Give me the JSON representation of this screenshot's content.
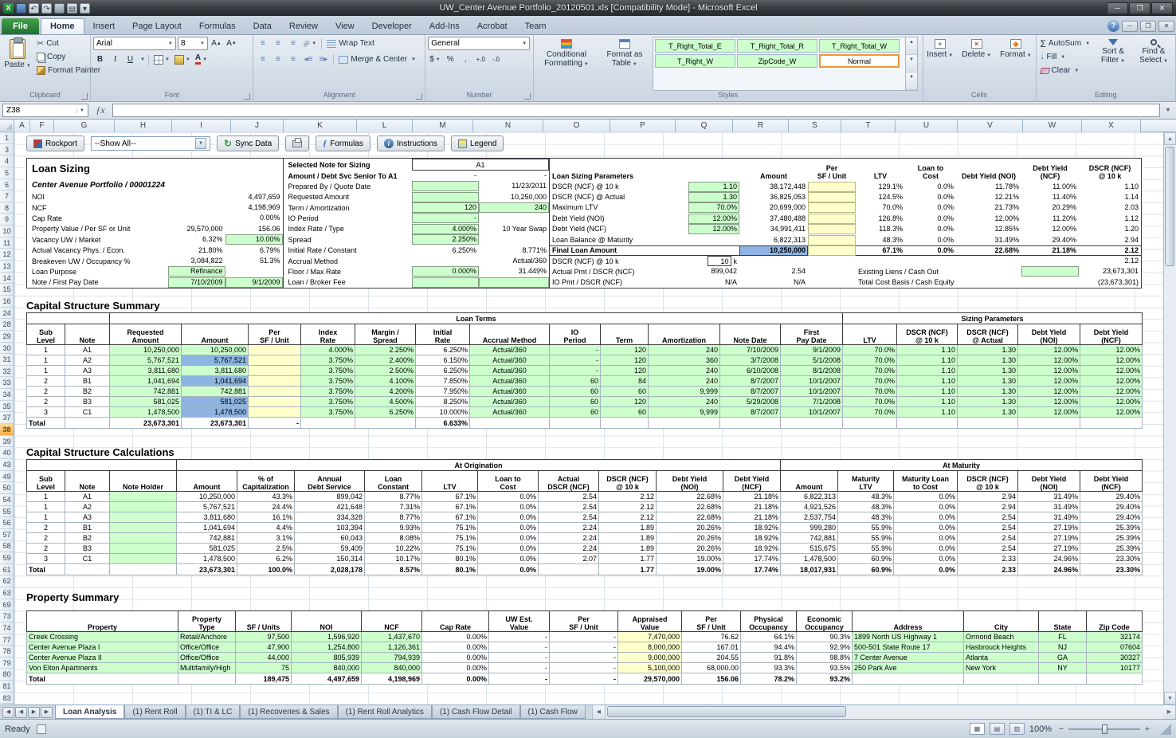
{
  "colors": {
    "input_green": "#ccffcc",
    "highlight_blue": "#8db4e2",
    "pale_yellow": "#ffffcc",
    "accent_orange": "#f29536"
  },
  "window": {
    "title": "UW_Center Avenue Portfolio_20120501.xls  [Compatibility Mode] -  Microsoft Excel"
  },
  "ribbon": {
    "tabs": [
      "File",
      "Home",
      "Insert",
      "Page Layout",
      "Formulas",
      "Data",
      "Review",
      "View",
      "Developer",
      "Add-Ins",
      "Acrobat",
      "Team"
    ],
    "active_tab": "Home",
    "groups": {
      "clipboard": {
        "label": "Clipboard",
        "paste": "Paste",
        "cut": "Cut",
        "copy": "Copy",
        "format_painter": "Format Painter"
      },
      "font": {
        "label": "Font",
        "family": "Arial",
        "size": "8"
      },
      "alignment": {
        "label": "Alignment",
        "wrap_text": "Wrap Text",
        "merge_center": "Merge & Center"
      },
      "number": {
        "label": "Number",
        "format": "General"
      },
      "styles": {
        "label": "Styles",
        "conditional_formatting": "Conditional Formatting",
        "format_as_table": "Format as Table",
        "cell_styles": [
          "T_Right_Total_E",
          "T_Right_Total_R",
          "T_Right_Total_W",
          "T_Right_W",
          "ZipCode_W",
          "Normal"
        ],
        "selected_style": "Normal"
      },
      "cells": {
        "label": "Cells",
        "insert": "Insert",
        "delete": "Delete",
        "format": "Format"
      },
      "editing": {
        "label": "Editing",
        "autosum": "AutoSum",
        "fill": "Fill",
        "clear": "Clear",
        "sort_filter": "Sort & Filter",
        "find_select": "Find & Select"
      }
    }
  },
  "formula_bar": {
    "name_box": "Z38",
    "formula": ""
  },
  "grid": {
    "columns": [
      "A",
      "F",
      "G",
      "H",
      "I",
      "J",
      "K",
      "L",
      "M",
      "N",
      "O",
      "P",
      "Q",
      "R",
      "S",
      "T",
      "U",
      "V",
      "W",
      "X"
    ],
    "rows": [
      "1",
      "3",
      "4",
      "5",
      "6",
      "7",
      "8",
      "9",
      "10",
      "11",
      "12",
      "13",
      "14",
      "15",
      "16",
      "24",
      "28",
      "29",
      "30",
      "31",
      "32",
      "33",
      "34",
      "35",
      "37",
      "38",
      "39",
      "40",
      "43",
      "49",
      "50",
      "54",
      "55",
      "56",
      "57",
      "58",
      "59",
      "61",
      "62",
      "63",
      "69",
      "73",
      "74",
      "77",
      "78",
      "79",
      "80",
      "81",
      "83"
    ],
    "selected_row": "38"
  },
  "sheet_toolbar": {
    "rockport": "Rockport",
    "show_all": "--Show All--",
    "sync_data": "Sync Data",
    "formulas": "Formulas",
    "instructions": "Instructions",
    "legend": "Legend"
  },
  "loan_sizing": {
    "title": "Loan Sizing",
    "subtitle": "Center Avenue Portfolio / 00001224",
    "left_rows": [
      [
        "NOI",
        "",
        "4,497,659",
        "--"
      ],
      [
        "NCF",
        "",
        "4,198,969",
        "--"
      ],
      [
        "Cap Rate",
        "",
        "0.00%",
        "--"
      ],
      [
        "Property Value / Per SF or Unit",
        "29,570,000",
        "156.06",
        "--"
      ],
      [
        "Vacancy UW / Market",
        "6.32%",
        "10.00%",
        "-g"
      ],
      [
        "Actual Vacancy Phys. / Econ.",
        "21.80%",
        "6.79%",
        "--"
      ],
      [
        "Breakeven UW / Occupancy %",
        "3,084,822",
        "51.3%",
        "--"
      ],
      [
        "Loan Purpose",
        "Refinance",
        "",
        "g-"
      ],
      [
        "Note / First Pay Date",
        "7/10/2009",
        "9/1/2009",
        "gg"
      ]
    ],
    "middle": {
      "selected_note_label": "Selected Note for Sizing",
      "selected_note": "A1",
      "senior_label": "Amount / Debt Svc Senior To A1",
      "senior_v1": "-",
      "senior_v2": "-",
      "rows": [
        [
          "Prepared By / Quote Date",
          "",
          "11/23/2011",
          "g-"
        ],
        [
          "Requested Amount",
          "",
          "10,250,000",
          "g-"
        ],
        [
          "Term / Amortization",
          "120",
          "240",
          "gg"
        ],
        [
          "IO Period",
          "-",
          "",
          "g-"
        ],
        [
          "Index Rate / Type",
          "4.000%",
          "10 Year Swap",
          "g-"
        ],
        [
          "Spread",
          "2.250%",
          "",
          "g-"
        ],
        [
          "Initial Rate / Constant",
          "6.250%",
          "8.771%",
          "--"
        ],
        [
          "Accrual Method",
          "",
          "Actual/360",
          "--"
        ],
        [
          "Floor / Max Rate",
          "0.000%",
          "31.449%",
          "g-"
        ],
        [
          "Loan / Broker Fee",
          "",
          "",
          "gg"
        ]
      ]
    },
    "params": {
      "header": [
        "Loan Sizing Parameters",
        "Amount",
        "Per\nSF / Unit",
        "LTV",
        "Loan to\nCost",
        "Debt Yield (NOI)",
        "Debt Yield\n(NCF)",
        "DSCR (NCF)\n@ 10 k"
      ],
      "rows": [
        [
          "DSCR (NCF) @ 10 k",
          "1.10",
          "38,172,448",
          "129.1%",
          "0.0%",
          "11.78%",
          "11.00%",
          "1.10",
          "g"
        ],
        [
          "DSCR (NCF) @ Actual",
          "1.30",
          "36,825,053",
          "124.5%",
          "0.0%",
          "12.21%",
          "11.40%",
          "1.14",
          "g"
        ],
        [
          "Maximum LTV",
          "70.0%",
          "20,699,000",
          "70.0%",
          "0.0%",
          "21.73%",
          "20.29%",
          "2.03",
          "g"
        ],
        [
          "Debt Yield (NOI)",
          "12.00%",
          "37,480,488",
          "126.8%",
          "0.0%",
          "12.00%",
          "11.20%",
          "1.12",
          "g"
        ],
        [
          "Debt Yield (NCF)",
          "12.00%",
          "34,991,411",
          "118.3%",
          "0.0%",
          "12.85%",
          "12.00%",
          "1.20",
          "g"
        ],
        [
          "Loan Balance @ Maturity",
          "",
          "6,822,313",
          "48.3%",
          "0.0%",
          "31.49%",
          "29.40%",
          "2.94",
          "-"
        ],
        [
          "Final Loan Amount",
          "",
          "10,250,000",
          "67.1%",
          "0.0%",
          "22.68%",
          "21.18%",
          "2.12",
          "final"
        ]
      ],
      "dscr_row": {
        "label": "DSCR (NCF) @ 10 k",
        "value": "10",
        "suffix": "k",
        "dscr": "2.12"
      },
      "pmt_rows": [
        {
          "label": "Actual Pmt / DSCR (NCF)",
          "v1": "899,042",
          "v2": "2.54",
          "right_label": "Existing Liens / Cash Out",
          "right_green": true,
          "right_value": "23,673,301"
        },
        {
          "label": "IO Pmt / DSCR (NCF)",
          "v1": "N/A",
          "v2": "N/A",
          "right_label": "Total Cost Basis / Cash Equity",
          "right_green": false,
          "right_value": "(23,673,301)"
        }
      ]
    }
  },
  "capital_structure_summary": {
    "title": "Capital Structure Summary",
    "bands": [
      "Loan Terms",
      "Sizing Parameters"
    ],
    "headers": [
      "Sub\nLevel",
      "Note",
      "Requested\nAmount",
      "Amount",
      "Per\nSF / Unit",
      "Index\nRate",
      "Margin /\nSpread",
      "Initial\nRate",
      "Accrual Method",
      "IO\nPeriod",
      "Term",
      "Amortization",
      "Note Date",
      "First\nPay Date",
      "LTV",
      "DSCR (NCF)\n@ 10 k",
      "DSCR (NCF)\n@ Actual",
      "Debt Yield\n(NOI)",
      "Debt Yield\n(NCF)"
    ],
    "rows": [
      [
        "1",
        "A1",
        "10,250,000",
        "10,250,000",
        "",
        "4.000%",
        "2.250%",
        "6.250%",
        "Actual/360",
        "-",
        "120",
        "240",
        "7/10/2009",
        "9/1/2009",
        "70.0%",
        "1.10",
        "1.30",
        "12.00%",
        "12.00%"
      ],
      [
        "1",
        "A2",
        "5,767,521",
        {
          "v": "5,767,521",
          "s": "b"
        },
        "",
        "3.750%",
        "2.400%",
        "6.150%",
        "Actual/360",
        "-",
        "120",
        "360",
        "3/7/2008",
        "5/1/2008",
        "70.0%",
        "1.10",
        "1.30",
        "12.00%",
        "12.00%"
      ],
      [
        "1",
        "A3",
        "3,811,680",
        "3,811,680",
        "",
        "3.750%",
        "2.500%",
        "6.250%",
        "Actual/360",
        "-",
        "120",
        "240",
        "6/10/2008",
        "8/1/2008",
        "70.0%",
        "1.10",
        "1.30",
        "12.00%",
        "12.00%"
      ],
      [
        "2",
        "B1",
        "1,041,694",
        {
          "v": "1,041,694",
          "s": "b"
        },
        "",
        "3.750%",
        "4.100%",
        "7.850%",
        "Actual/360",
        "60",
        "84",
        "240",
        "8/7/2007",
        "10/1/2007",
        "70.0%",
        "1.10",
        "1.30",
        "12.00%",
        "12.00%"
      ],
      [
        "2",
        "B2",
        "742,881",
        "742,881",
        "",
        "3.750%",
        "4.200%",
        "7.950%",
        "Actual/360",
        "60",
        "60",
        "9,999",
        "8/7/2007",
        "10/1/2007",
        "70.0%",
        "1.10",
        "1.30",
        "12.00%",
        "12.00%"
      ],
      [
        "2",
        "B3",
        "581,025",
        {
          "v": "581,025",
          "s": "b"
        },
        "",
        "3.750%",
        "4.500%",
        "8.250%",
        "Actual/360",
        "60",
        "120",
        "240",
        "5/29/2008",
        "7/1/2008",
        "70.0%",
        "1.10",
        "1.30",
        "12.00%",
        "12.00%"
      ],
      [
        "3",
        "C1",
        "1,478,500",
        {
          "v": "1,478,500",
          "s": "b"
        },
        "",
        "3.750%",
        "6.250%",
        "10.000%",
        "Actual/360",
        "60",
        "60",
        "9,999",
        "8/7/2007",
        "10/1/2007",
        "70.0%",
        "1.10",
        "1.30",
        "12.00%",
        "12.00%"
      ]
    ],
    "total_row": [
      "Total",
      "",
      "23,673,301",
      "23,673,301",
      "-",
      "",
      "",
      "6.633%",
      "",
      "",
      "",
      "",
      "",
      "",
      "",
      "",
      "",
      "",
      ""
    ]
  },
  "capital_structure_calculations": {
    "title": "Capital Structure Calculations",
    "bands": [
      "At Origination",
      "At Maturity"
    ],
    "headers": [
      "Sub\nLevel",
      "Note",
      "Note Holder",
      "Amount",
      "% of\nCapitalization",
      "Annual\nDebt Service",
      "Loan\nConstant",
      "LTV",
      "Loan to\nCost",
      "Actual\nDSCR (NCF)",
      "DSCR (NCF)\n@ 10 k",
      "Debt Yield\n(NOI)",
      "Debt Yield\n(NCF)",
      "Amount",
      "Maturity\nLTV",
      "Maturity Loan\nto Cost",
      "DSCR (NCF)\n@ 10 k",
      "Debt Yield\n(NOI)",
      "Debt Yield\n(NCF)"
    ],
    "rows": [
      [
        "1",
        "A1",
        "",
        "10,250,000",
        "43.3%",
        "899,042",
        "8.77%",
        "67.1%",
        "0.0%",
        "2.54",
        "2.12",
        "22.68%",
        "21.18%",
        "6,822,313",
        "48.3%",
        "0.0%",
        "2.94",
        "31.49%",
        "29.40%"
      ],
      [
        "1",
        "A2",
        "",
        "5,767,521",
        "24.4%",
        "421,648",
        "7.31%",
        "67.1%",
        "0.0%",
        "2.54",
        "2.12",
        "22.68%",
        "21.18%",
        "4,921,526",
        "48.3%",
        "0.0%",
        "2.94",
        "31.49%",
        "29.40%"
      ],
      [
        "1",
        "A3",
        "",
        "3,811,680",
        "16.1%",
        "334,328",
        "8.77%",
        "67.1%",
        "0.0%",
        "2.54",
        "2.12",
        "22.68%",
        "21.18%",
        "2,537,754",
        "48.3%",
        "0.0%",
        "2.54",
        "31.49%",
        "29.40%"
      ],
      [
        "2",
        "B1",
        "",
        "1,041,694",
        "4.4%",
        "103,394",
        "9.93%",
        "75.1%",
        "0.0%",
        "2.24",
        "1.89",
        "20.26%",
        "18.92%",
        "999,280",
        "55.9%",
        "0.0%",
        "2.54",
        "27.19%",
        "25.39%"
      ],
      [
        "2",
        "B2",
        "",
        "742,881",
        "3.1%",
        "60,043",
        "8.08%",
        "75.1%",
        "0.0%",
        "2.24",
        "1.89",
        "20.26%",
        "18.92%",
        "742,881",
        "55.9%",
        "0.0%",
        "2.54",
        "27.19%",
        "25.39%"
      ],
      [
        "2",
        "B3",
        "",
        "581,025",
        "2.5%",
        "59,409",
        "10.22%",
        "75.1%",
        "0.0%",
        "2.24",
        "1.89",
        "20.26%",
        "18.92%",
        "515,675",
        "55.9%",
        "0.0%",
        "2.54",
        "27.19%",
        "25.39%"
      ],
      [
        "3",
        "C1",
        "",
        "1,478,500",
        "6.2%",
        "150,314",
        "10.17%",
        "80.1%",
        "0.0%",
        "2.07",
        "1.77",
        "19.00%",
        "17.74%",
        "1,478,500",
        "60.9%",
        "0.0%",
        "2.33",
        "24.96%",
        "23.30%"
      ]
    ],
    "total_row": [
      "Total",
      "",
      "",
      "23,673,301",
      "100.0%",
      "2,028,178",
      "8.57%",
      "80.1%",
      "0.0%",
      "",
      "1.77",
      "19.00%",
      "17.74%",
      "18,017,931",
      "60.9%",
      "0.0%",
      "2.33",
      "24.96%",
      "23.30%"
    ]
  },
  "property_summary": {
    "title": "Property Summary",
    "headers": [
      "Property",
      "Property\nType",
      "SF / Units",
      "NOI",
      "NCF",
      "Cap Rate",
      "UW Est.\nValue",
      "Per\nSF / Unit",
      "Appraised\nValue",
      "Per\nSF / Unit",
      "Physical\nOccupancy",
      "Economic\nOccupancy",
      "Address",
      "City",
      "State",
      "Zip Code"
    ],
    "rows": [
      [
        "Creek Crossing",
        "Retail/Anchore",
        "97,500",
        "1,596,920",
        "1,437,670",
        "0.00%",
        "-",
        "-",
        "7,470,000",
        "76.62",
        "64.1%",
        "90.3%",
        "1899 North US Highway 1",
        "Ormond Beach",
        "FL",
        "32174"
      ],
      [
        "Center Avenue Plaza I",
        "Office/Office",
        "47,900",
        "1,254,800",
        "1,126,361",
        "0.00%",
        "-",
        "-",
        "8,000,000",
        "167.01",
        "94.4%",
        "92.9%",
        "500-501 State Route 17",
        "Hasbrouck Heights",
        "NJ",
        "07604"
      ],
      [
        "Center Avenue Plaza II",
        "Office/Office",
        "44,000",
        "805,939",
        "794,939",
        "0.00%",
        "-",
        "-",
        "9,000,000",
        "204.55",
        "91.8%",
        "98.8%",
        "7 Center Avenue",
        "Atlanta",
        "GA",
        "30327"
      ],
      [
        "Von Elton Apartments",
        "Multifamily/High",
        "75",
        "840,000",
        "840,000",
        "0.00%",
        "-",
        "-",
        "5,100,000",
        "68,000.00",
        "93.3%",
        "93.5%",
        "250 Park Ave",
        "New York",
        "NY",
        "10177"
      ]
    ],
    "total_row": [
      "Total",
      "",
      "189,475",
      "4,497,659",
      "4,198,969",
      "0.00%",
      "-",
      "-",
      "29,570,000",
      "156.06",
      "78.2%",
      "93.2%",
      "",
      "",
      "",
      ""
    ]
  },
  "sheet_tabs": {
    "tabs": [
      "Loan Analysis",
      "(1) Rent Roll",
      "(1) TI & LC",
      "(1) Recoveries & Sales",
      "(1) Rent Roll Analytics",
      "(1) Cash Flow Detail",
      "(1) Cash Flow"
    ],
    "active": "Loan Analysis"
  },
  "status_bar": {
    "mode": "Ready",
    "zoom": "100%"
  }
}
